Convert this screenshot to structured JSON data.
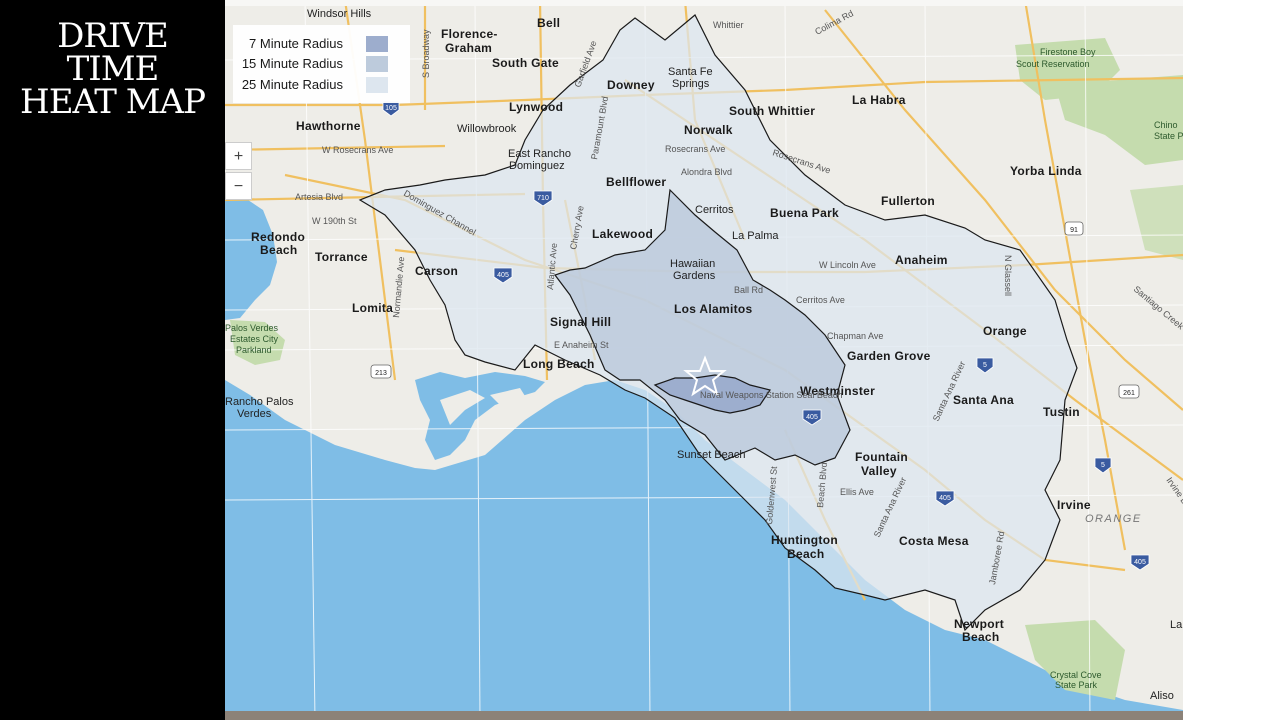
{
  "title": {
    "line1": "DRIVE TIME",
    "line2": "HEAT MAP"
  },
  "legend": {
    "items": [
      {
        "label": "7 Minute Radius",
        "color": "#9aabcc"
      },
      {
        "label": "15 Minute Radius",
        "color": "#bccadc"
      },
      {
        "label": "25 Minute Radius",
        "color": "#dde6f0"
      }
    ]
  },
  "zoom": {
    "in": "+",
    "out": "−"
  },
  "colors": {
    "ocean": "#7fbde6",
    "land": "#eeede8",
    "park": "#c5dcae",
    "highway": "#f0c060",
    "boundary": "#1a1a1a"
  },
  "map": {
    "cities": [
      "Windsor Hills",
      "Florence-",
      "Graham",
      "Bell",
      "South Gate",
      "Downey",
      "Santa Fe",
      "Springs",
      "South Whittier",
      "La Habra",
      "Lynwood",
      "Hawthorne",
      "Willowbrook",
      "Norwalk",
      "East Rancho",
      "Dominguez",
      "Bellflower",
      "Yorba Linda",
      "Fullerton",
      "Cerritos",
      "Buena Park",
      "Redondo",
      "Beach",
      "Torrance",
      "Carson",
      "Lakewood",
      "La Palma",
      "Anaheim",
      "Hawaiian",
      "Gardens",
      "Lomita",
      "Signal Hill",
      "Los Alamitos",
      "Orange",
      "Long Beach",
      "Garden Grove",
      "Westminster",
      "Santa Ana",
      "Tustin",
      "Rancho Palos",
      "Verdes",
      "Sunset Beach",
      "Fountain",
      "Valley",
      "Irvine",
      "Huntington",
      "Beach",
      "Costa Mesa",
      "Newport",
      "Beach",
      "Aliso",
      "La"
    ],
    "streets": [
      "Whittier",
      "Colima Rd",
      "S Broadway",
      "Garfield Ave",
      "Paramount Blvd",
      "W Rosecrans Ave",
      "Rosecrans Ave",
      "Rosecrans Ave",
      "Alondra Blvd",
      "Artesia Blvd",
      "W 190th St",
      "Dominguez Channel",
      "Cherry Ave",
      "Atlantic Ave",
      "Normandie Ave",
      "E Anaheim St",
      "W Lincoln Ave",
      "Ball Rd",
      "Cerritos Ave",
      "Chapman Ave",
      "Santa Ana River",
      "Santiago Creek",
      "N Glassell",
      "Goldenwest St",
      "Beach Blvd",
      "Ellis Ave",
      "Santa Ana River",
      "Jamboree Rd",
      "Irvine Blvd",
      "Naval Weapons Station Seal Beach"
    ],
    "parks": [
      "Palos Verdes",
      "Estates City",
      "Parkland",
      "Firestone Boy",
      "Scout Reservation",
      "Chino",
      "State P",
      "Crystal Cove",
      "State Park"
    ],
    "region": "ORANGE",
    "shields": [
      "105",
      "710",
      "405",
      "405",
      "91",
      "5",
      "261",
      "405",
      "5",
      "405",
      "213"
    ]
  }
}
